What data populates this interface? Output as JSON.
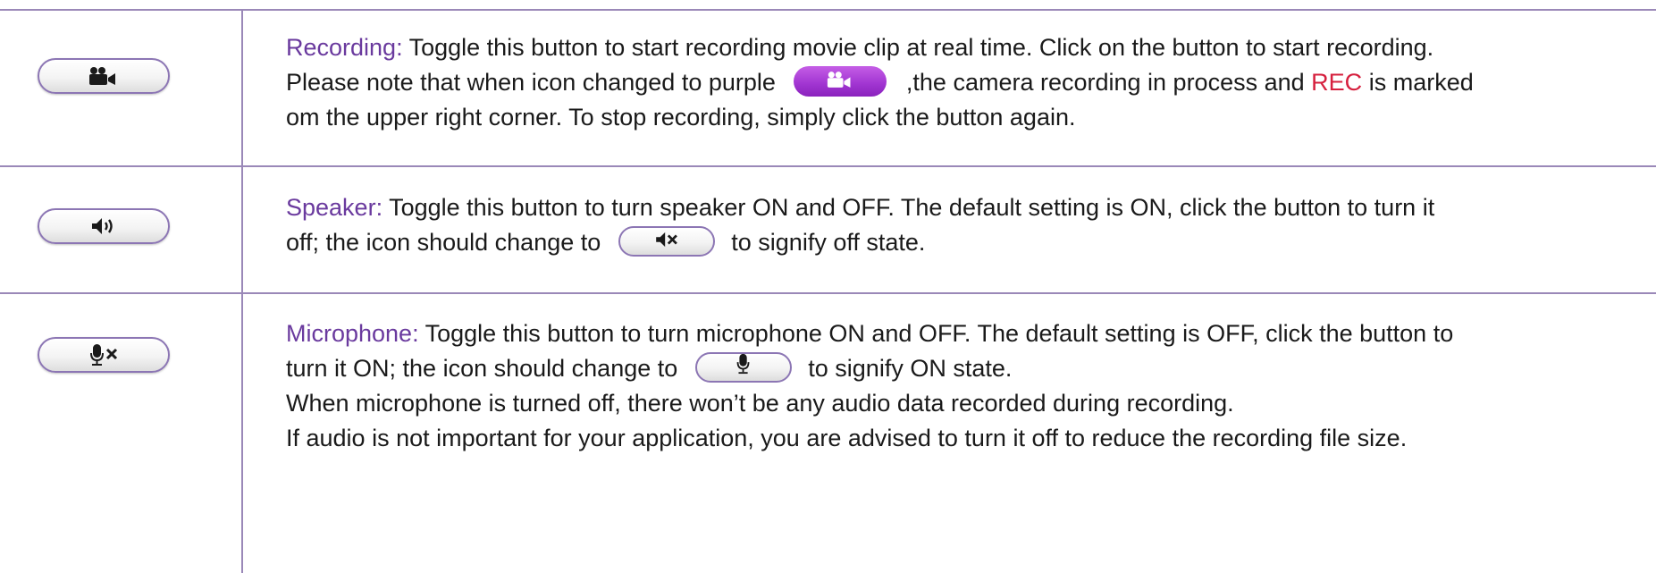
{
  "rows": [
    {
      "button_icon": "video-camera-icon",
      "label": "Recording:",
      "lines": [
        "Toggle this button to start recording movie clip at real time. Click on the button to start recording.",
        "Please note that when icon changed to purple",
        ",the camera recording in process and",
        "REC",
        "is marked",
        "om the upper right corner. To stop recording, simply click the button again."
      ]
    },
    {
      "button_icon": "speaker-on-icon",
      "label": "Speaker:",
      "lines": [
        "Toggle this button to turn speaker ON and OFF. The default setting is ON, click the button to turn it",
        "off; the icon should change to",
        "to signify off state."
      ]
    },
    {
      "button_icon": "microphone-muted-icon",
      "label": "Microphone:",
      "lines": [
        "Toggle this button to turn microphone ON and OFF.  The default setting is OFF, click the button to",
        "turn it ON; the icon should change to",
        "to signify ON state.",
        "When microphone is turned off, there won’t be any audio data recorded during recording.",
        "If audio is not important for your application, you are advised to turn it off to reduce the recording file size."
      ]
    }
  ],
  "colors": {
    "label": "#6a3a9e",
    "rec": "#d6203e",
    "border": "#9a88b8",
    "active_button": "#a337d3"
  }
}
